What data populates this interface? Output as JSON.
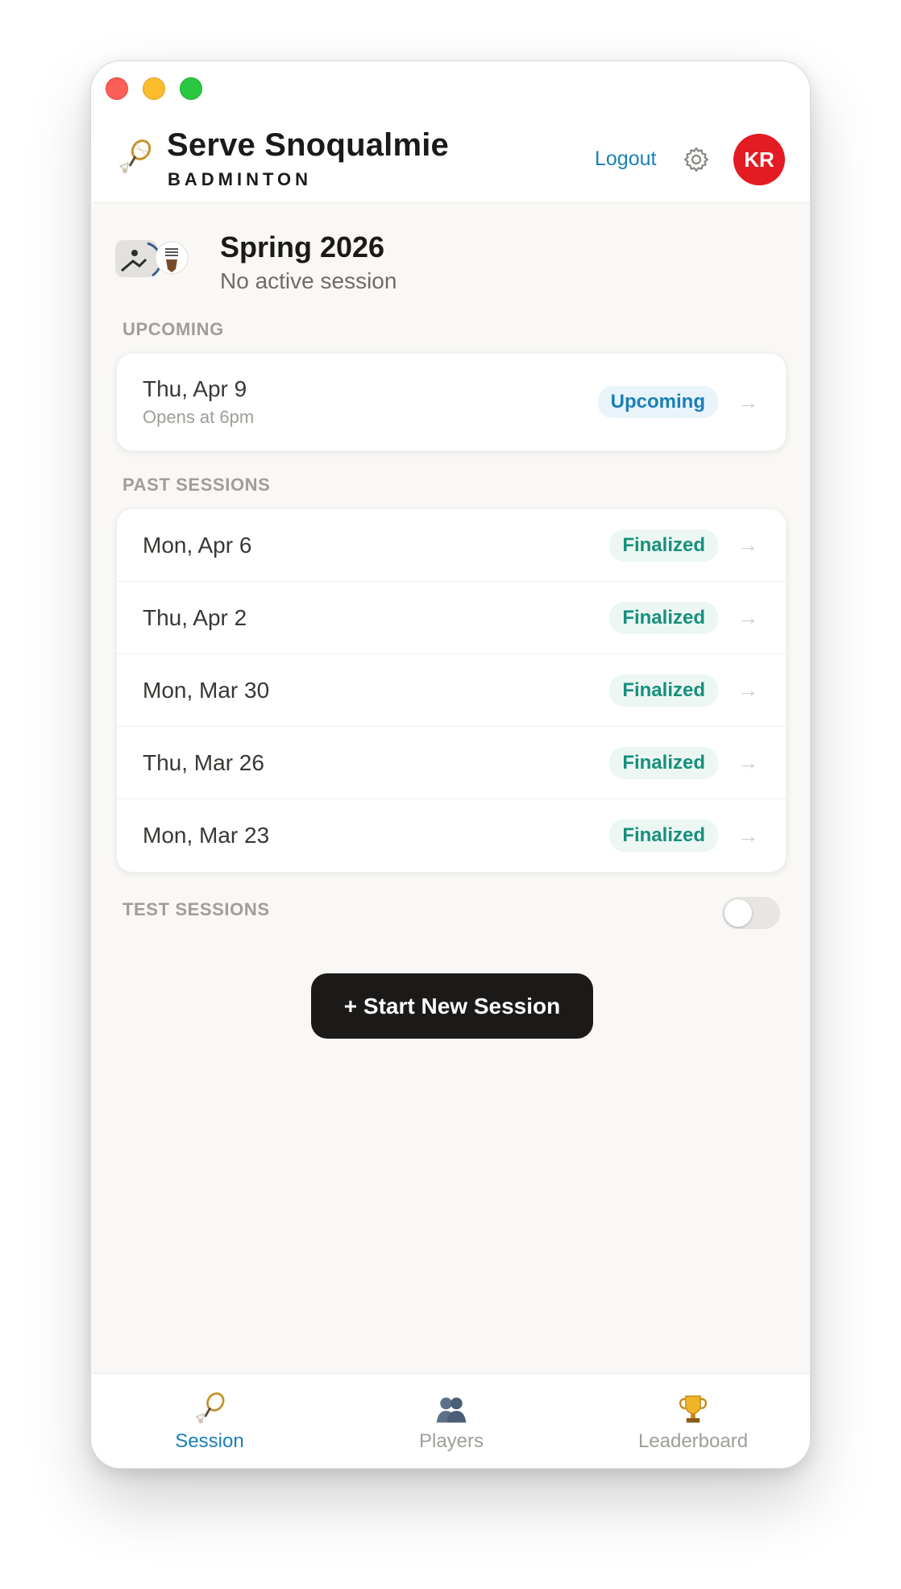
{
  "header": {
    "title": "Serve Snoqualmie",
    "subtitle": "BADMINTON",
    "logout_label": "Logout",
    "avatar_initials": "KR"
  },
  "season": {
    "title": "Spring 2026",
    "status": "No active session"
  },
  "upcoming": {
    "label": "UPCOMING",
    "items": [
      {
        "date": "Thu, Apr 9",
        "sub": "Opens at 6pm",
        "badge": "Upcoming"
      }
    ]
  },
  "past": {
    "label": "PAST SESSIONS",
    "items": [
      {
        "date": "Mon, Apr 6",
        "badge": "Finalized"
      },
      {
        "date": "Thu, Apr 2",
        "badge": "Finalized"
      },
      {
        "date": "Mon, Mar 30",
        "badge": "Finalized"
      },
      {
        "date": "Thu, Mar 26",
        "badge": "Finalized"
      },
      {
        "date": "Mon, Mar 23",
        "badge": "Finalized"
      }
    ]
  },
  "test_sessions": {
    "label": "TEST SESSIONS",
    "enabled": false
  },
  "actions": {
    "start_label": "+ Start New Session"
  },
  "tabs": [
    {
      "label": "Session",
      "icon": "badminton-icon",
      "active": true
    },
    {
      "label": "Players",
      "icon": "players-icon",
      "active": false
    },
    {
      "label": "Leaderboard",
      "icon": "trophy-icon",
      "active": false
    }
  ],
  "colors": {
    "accent": "#1a7fb8",
    "finalized": "#16907c",
    "avatar": "#e31b23",
    "button": "#1c1a18"
  }
}
